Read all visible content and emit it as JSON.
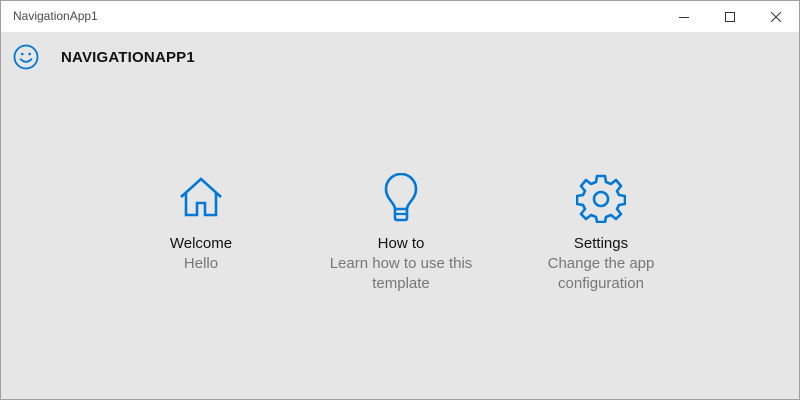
{
  "window": {
    "title": "NavigationApp1"
  },
  "header": {
    "icon": "smiley-face-icon",
    "title": "NAVIGATIONAPP1"
  },
  "tiles": [
    {
      "icon": "home-icon",
      "title": "Welcome",
      "description": "Hello"
    },
    {
      "icon": "lightbulb-icon",
      "title": "How to",
      "description": "Learn how to use this template"
    },
    {
      "icon": "gear-icon",
      "title": "Settings",
      "description": "Change the app configuration"
    }
  ],
  "colors": {
    "accent": "#0078d7",
    "background": "#e6e6e6",
    "titlebar": "#ffffff",
    "description_text": "#777777"
  }
}
